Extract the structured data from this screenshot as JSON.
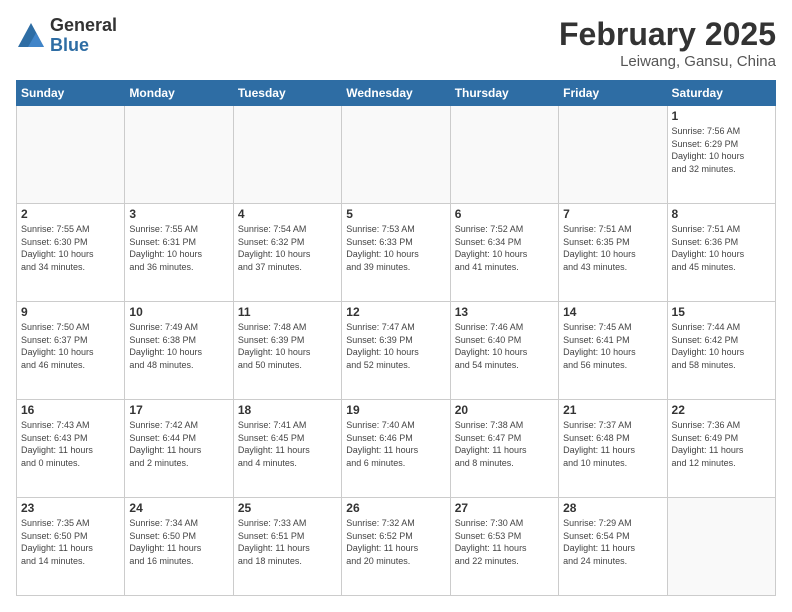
{
  "logo": {
    "general": "General",
    "blue": "Blue"
  },
  "header": {
    "month_year": "February 2025",
    "location": "Leiwang, Gansu, China"
  },
  "weekdays": [
    "Sunday",
    "Monday",
    "Tuesday",
    "Wednesday",
    "Thursday",
    "Friday",
    "Saturday"
  ],
  "weeks": [
    [
      {
        "day": "",
        "detail": ""
      },
      {
        "day": "",
        "detail": ""
      },
      {
        "day": "",
        "detail": ""
      },
      {
        "day": "",
        "detail": ""
      },
      {
        "day": "",
        "detail": ""
      },
      {
        "day": "",
        "detail": ""
      },
      {
        "day": "1",
        "detail": "Sunrise: 7:56 AM\nSunset: 6:29 PM\nDaylight: 10 hours\nand 32 minutes."
      }
    ],
    [
      {
        "day": "2",
        "detail": "Sunrise: 7:55 AM\nSunset: 6:30 PM\nDaylight: 10 hours\nand 34 minutes."
      },
      {
        "day": "3",
        "detail": "Sunrise: 7:55 AM\nSunset: 6:31 PM\nDaylight: 10 hours\nand 36 minutes."
      },
      {
        "day": "4",
        "detail": "Sunrise: 7:54 AM\nSunset: 6:32 PM\nDaylight: 10 hours\nand 37 minutes."
      },
      {
        "day": "5",
        "detail": "Sunrise: 7:53 AM\nSunset: 6:33 PM\nDaylight: 10 hours\nand 39 minutes."
      },
      {
        "day": "6",
        "detail": "Sunrise: 7:52 AM\nSunset: 6:34 PM\nDaylight: 10 hours\nand 41 minutes."
      },
      {
        "day": "7",
        "detail": "Sunrise: 7:51 AM\nSunset: 6:35 PM\nDaylight: 10 hours\nand 43 minutes."
      },
      {
        "day": "8",
        "detail": "Sunrise: 7:51 AM\nSunset: 6:36 PM\nDaylight: 10 hours\nand 45 minutes."
      }
    ],
    [
      {
        "day": "9",
        "detail": "Sunrise: 7:50 AM\nSunset: 6:37 PM\nDaylight: 10 hours\nand 46 minutes."
      },
      {
        "day": "10",
        "detail": "Sunrise: 7:49 AM\nSunset: 6:38 PM\nDaylight: 10 hours\nand 48 minutes."
      },
      {
        "day": "11",
        "detail": "Sunrise: 7:48 AM\nSunset: 6:39 PM\nDaylight: 10 hours\nand 50 minutes."
      },
      {
        "day": "12",
        "detail": "Sunrise: 7:47 AM\nSunset: 6:39 PM\nDaylight: 10 hours\nand 52 minutes."
      },
      {
        "day": "13",
        "detail": "Sunrise: 7:46 AM\nSunset: 6:40 PM\nDaylight: 10 hours\nand 54 minutes."
      },
      {
        "day": "14",
        "detail": "Sunrise: 7:45 AM\nSunset: 6:41 PM\nDaylight: 10 hours\nand 56 minutes."
      },
      {
        "day": "15",
        "detail": "Sunrise: 7:44 AM\nSunset: 6:42 PM\nDaylight: 10 hours\nand 58 minutes."
      }
    ],
    [
      {
        "day": "16",
        "detail": "Sunrise: 7:43 AM\nSunset: 6:43 PM\nDaylight: 11 hours\nand 0 minutes."
      },
      {
        "day": "17",
        "detail": "Sunrise: 7:42 AM\nSunset: 6:44 PM\nDaylight: 11 hours\nand 2 minutes."
      },
      {
        "day": "18",
        "detail": "Sunrise: 7:41 AM\nSunset: 6:45 PM\nDaylight: 11 hours\nand 4 minutes."
      },
      {
        "day": "19",
        "detail": "Sunrise: 7:40 AM\nSunset: 6:46 PM\nDaylight: 11 hours\nand 6 minutes."
      },
      {
        "day": "20",
        "detail": "Sunrise: 7:38 AM\nSunset: 6:47 PM\nDaylight: 11 hours\nand 8 minutes."
      },
      {
        "day": "21",
        "detail": "Sunrise: 7:37 AM\nSunset: 6:48 PM\nDaylight: 11 hours\nand 10 minutes."
      },
      {
        "day": "22",
        "detail": "Sunrise: 7:36 AM\nSunset: 6:49 PM\nDaylight: 11 hours\nand 12 minutes."
      }
    ],
    [
      {
        "day": "23",
        "detail": "Sunrise: 7:35 AM\nSunset: 6:50 PM\nDaylight: 11 hours\nand 14 minutes."
      },
      {
        "day": "24",
        "detail": "Sunrise: 7:34 AM\nSunset: 6:50 PM\nDaylight: 11 hours\nand 16 minutes."
      },
      {
        "day": "25",
        "detail": "Sunrise: 7:33 AM\nSunset: 6:51 PM\nDaylight: 11 hours\nand 18 minutes."
      },
      {
        "day": "26",
        "detail": "Sunrise: 7:32 AM\nSunset: 6:52 PM\nDaylight: 11 hours\nand 20 minutes."
      },
      {
        "day": "27",
        "detail": "Sunrise: 7:30 AM\nSunset: 6:53 PM\nDaylight: 11 hours\nand 22 minutes."
      },
      {
        "day": "28",
        "detail": "Sunrise: 7:29 AM\nSunset: 6:54 PM\nDaylight: 11 hours\nand 24 minutes."
      },
      {
        "day": "",
        "detail": ""
      }
    ]
  ]
}
